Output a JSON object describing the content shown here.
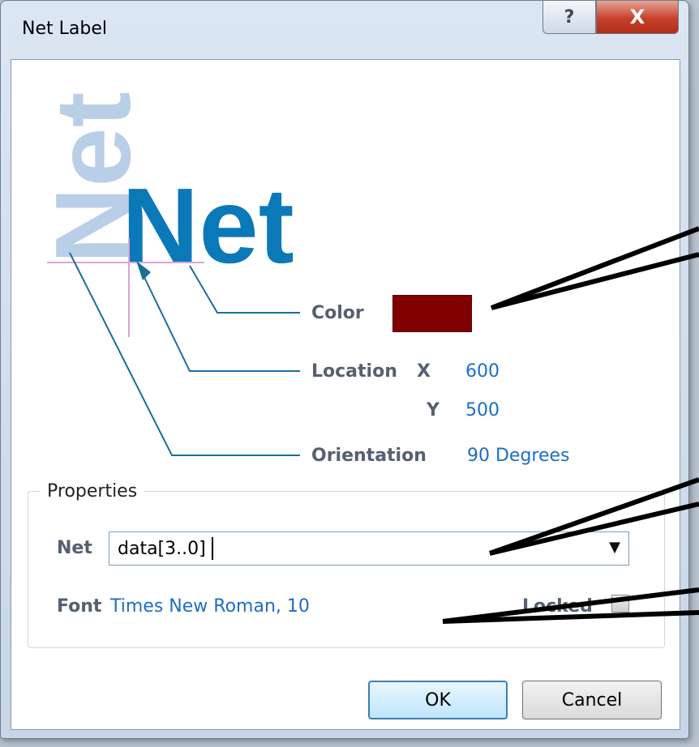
{
  "window": {
    "title": "Net Label",
    "help_label": "?",
    "close_label": "X"
  },
  "preview": {
    "rotated_text": "Net",
    "horizontal_text": "Net"
  },
  "fields": {
    "color_label": "Color",
    "color_value": "#800000",
    "location_label": "Location",
    "x_label": "X",
    "x_value": "600",
    "y_label": "Y",
    "y_value": "500",
    "orientation_label": "Orientation",
    "orientation_value": "90 Degrees"
  },
  "properties": {
    "title": "Properties",
    "net_label": "Net",
    "net_value": "data[3..0]",
    "font_label": "Font",
    "font_value": "Times New Roman, 10",
    "locked_label": "Locked",
    "locked_checked": false
  },
  "buttons": {
    "ok_label": "OK",
    "cancel_label": "Cancel"
  },
  "colors": {
    "accent_blue": "#0b79b8",
    "light_blue": "#b9cfe8",
    "value_blue": "#1c6ec6",
    "leader_line": "#1a6e9a"
  }
}
